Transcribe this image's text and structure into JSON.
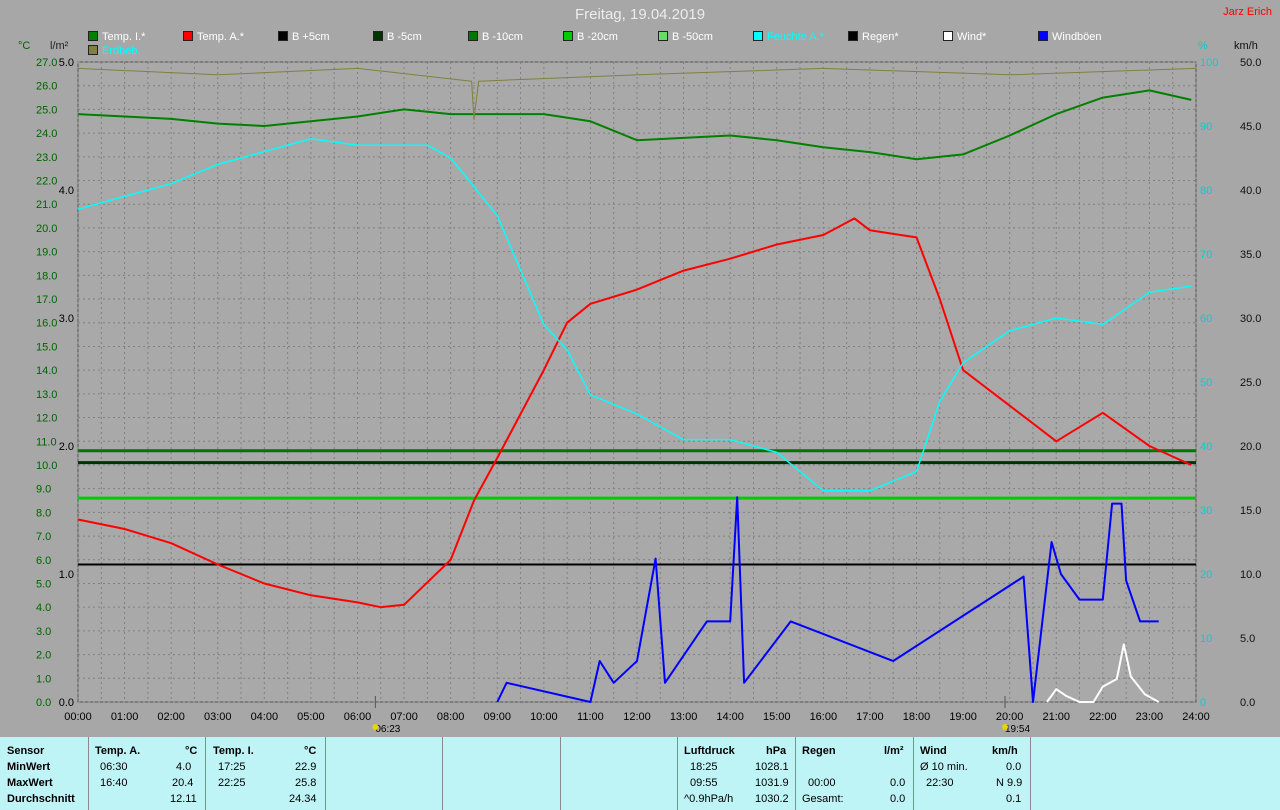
{
  "header": {
    "title": "Freitag, 19.04.2019",
    "author": "Jarz Erich"
  },
  "legend": [
    {
      "label": "Temp. I.*",
      "color": "#008000"
    },
    {
      "label": "Temp. A.*",
      "color": "#ff0000"
    },
    {
      "label": "B +5cm",
      "color": "#000000"
    },
    {
      "label": "B -5cm",
      "color": "#003300"
    },
    {
      "label": "B -10cm",
      "color": "#007700"
    },
    {
      "label": "B -20cm",
      "color": "#00cc00"
    },
    {
      "label": "B -50cm",
      "color": "#66dd66"
    },
    {
      "label": "Feuchte A.*",
      "color": "#00ffff"
    },
    {
      "label": "Regen*",
      "color": "#000000"
    },
    {
      "label": "Wind*",
      "color": "#ffffff"
    },
    {
      "label": "Windböen",
      "color": "#0000ff"
    },
    {
      "label": "Erdbeb.",
      "color": "#808040"
    }
  ],
  "units": {
    "left1": "°C",
    "left2": "l/m²",
    "right1": "%",
    "right2": "km/h"
  },
  "markers": {
    "sunrise": "06:23",
    "sunset": "19:54"
  },
  "chart_data": {
    "type": "line",
    "x_ticks": [
      "00:00",
      "01:00",
      "02:00",
      "03:00",
      "04:00",
      "05:00",
      "06:00",
      "07:00",
      "08:00",
      "09:00",
      "10:00",
      "11:00",
      "12:00",
      "13:00",
      "14:00",
      "15:00",
      "16:00",
      "17:00",
      "18:00",
      "19:00",
      "20:00",
      "21:00",
      "22:00",
      "23:00",
      "24:00"
    ],
    "xlim_hours": [
      0,
      24
    ],
    "y_temp": {
      "range": [
        0,
        27
      ],
      "ticks": [
        "0.0",
        "1.0",
        "2.0",
        "3.0",
        "4.0",
        "5.0",
        "6.0",
        "7.0",
        "8.0",
        "9.0",
        "10.0",
        "11.0",
        "12.0",
        "13.0",
        "14.0",
        "15.0",
        "16.0",
        "17.0",
        "18.0",
        "19.0",
        "20.0",
        "21.0",
        "22.0",
        "23.0",
        "24.0",
        "25.0",
        "26.0",
        "27.0"
      ]
    },
    "y_rain": {
      "range": [
        0,
        5
      ],
      "ticks": [
        "0.0",
        "1.0",
        "2.0",
        "3.0",
        "4.0",
        "5.0"
      ]
    },
    "y_humidity": {
      "range": [
        0,
        100
      ],
      "ticks": [
        "0",
        "10",
        "20",
        "30",
        "40",
        "50",
        "60",
        "70",
        "80",
        "90",
        "100"
      ]
    },
    "y_wind": {
      "range": [
        0,
        50
      ],
      "ticks": [
        "0.0",
        "5.0",
        "10.0",
        "15.0",
        "20.0",
        "25.0",
        "30.0",
        "35.0",
        "40.0",
        "45.0",
        "50.0"
      ]
    },
    "grid": true,
    "series": [
      {
        "name": "Temp. I.*",
        "axis": "temp",
        "color": "#008000",
        "x": [
          0,
          1,
          2,
          3,
          4,
          5,
          6,
          7,
          8,
          9,
          10,
          11,
          12,
          13,
          14,
          15,
          16,
          17,
          18,
          19,
          20,
          21,
          22,
          23,
          23.9
        ],
        "y": [
          24.8,
          24.7,
          24.6,
          24.4,
          24.3,
          24.5,
          24.7,
          25.0,
          24.8,
          24.8,
          24.8,
          24.5,
          23.7,
          23.8,
          23.9,
          23.7,
          23.4,
          23.2,
          22.9,
          23.1,
          23.9,
          24.8,
          25.5,
          25.8,
          25.4
        ]
      },
      {
        "name": "Temp. A.*",
        "axis": "temp",
        "color": "#ff0000",
        "x": [
          0,
          1,
          2,
          3,
          4,
          5,
          6,
          6.5,
          7,
          8,
          8.5,
          9,
          10,
          10.5,
          11,
          12,
          13,
          14,
          15,
          16,
          16.67,
          17,
          18,
          18.5,
          19,
          20,
          21,
          22,
          23,
          23.9
        ],
        "y": [
          7.7,
          7.3,
          6.7,
          5.8,
          5.0,
          4.5,
          4.2,
          4.0,
          4.1,
          6.0,
          8.5,
          10.3,
          14.0,
          16.0,
          16.8,
          17.4,
          18.2,
          18.7,
          19.3,
          19.7,
          20.4,
          19.9,
          19.6,
          17.0,
          14.0,
          12.5,
          11.0,
          12.2,
          10.8,
          10.0
        ]
      },
      {
        "name": "Feuchte A.*",
        "axis": "humidity",
        "color": "#00ffff",
        "x": [
          0,
          1,
          2,
          3,
          4,
          5,
          6,
          7,
          7.5,
          8,
          9,
          10,
          10.5,
          11,
          12,
          13,
          14,
          15,
          16,
          16.5,
          17,
          18,
          18.5,
          19,
          20,
          21,
          22,
          23,
          23.9
        ],
        "y": [
          77,
          79,
          81,
          84,
          86,
          88,
          87,
          87,
          87,
          85,
          76,
          59,
          55,
          48,
          45,
          41,
          41,
          39,
          33,
          33,
          33,
          36,
          47,
          53,
          58,
          60,
          59,
          64,
          65
        ]
      },
      {
        "name": "Erdbeb.",
        "axis": "humidity",
        "color": "#808040",
        "x": [
          0,
          3,
          6,
          8.45,
          8.5,
          8.6,
          12,
          16,
          20,
          24
        ],
        "y": [
          99,
          98,
          99,
          97,
          91,
          97,
          98,
          99,
          98,
          99
        ]
      },
      {
        "name": "Wind*",
        "axis": "wind",
        "color": "#ffffff",
        "x": [
          20.8,
          21.0,
          21.2,
          21.5,
          21.8,
          22.0,
          22.3,
          22.45,
          22.6,
          22.9,
          23.2
        ],
        "y": [
          0,
          1,
          0.5,
          0,
          0,
          1.2,
          1.8,
          4.5,
          2.0,
          0.6,
          0
        ]
      },
      {
        "name": "Windböen",
        "axis": "wind",
        "color": "#0000ff",
        "x": [
          9,
          9.2,
          11,
          11.2,
          11.5,
          12,
          12.4,
          12.6,
          13.5,
          14.0,
          14.15,
          14.3,
          15.3,
          17.5,
          20.3,
          20.5,
          20.9,
          21.1,
          21.5,
          22.0,
          22.2,
          22.4,
          22.5,
          22.8,
          23.2
        ],
        "y": [
          0,
          1.5,
          0,
          3.2,
          1.5,
          3.2,
          11.2,
          1.5,
          6.3,
          6.3,
          16.0,
          1.5,
          6.3,
          3.2,
          9.8,
          0,
          12.5,
          10,
          8,
          8,
          15.5,
          15.5,
          9.5,
          6.3,
          6.3
        ]
      }
    ],
    "reference_lines": [
      {
        "label": "B -10cm",
        "axis": "temp",
        "value": 10.6,
        "color": "#007700"
      },
      {
        "label": "B -5cm",
        "axis": "temp",
        "value": 10.1,
        "color": "#003300"
      },
      {
        "label": "B -20cm",
        "axis": "temp",
        "value": 8.6,
        "color": "#00cc00"
      },
      {
        "label": "B +5cm",
        "axis": "temp",
        "value": 5.8,
        "color": "#000000"
      }
    ]
  },
  "stats": {
    "sensor": {
      "label": "Sensor",
      "min": "MinWert",
      "max": "MaxWert",
      "avg": "Durchschnitt"
    },
    "temp_a": {
      "label": "Temp. A.",
      "unit": "°C",
      "min_time": "06:30",
      "min_val": "4.0",
      "max_time": "16:40",
      "max_val": "20.4",
      "avg": "12.11"
    },
    "temp_i": {
      "label": "Temp. I.",
      "unit": "°C",
      "min_time": "17:25",
      "min_val": "22.9",
      "max_time": "22:25",
      "max_val": "25.8",
      "avg": "24.34"
    },
    "pressure": {
      "label": "Luftdruck",
      "unit": "hPa",
      "min_time": "18:25",
      "min_val": "1028.1",
      "max_time": "09:55",
      "max_val": "1031.9",
      "trend_label": "^0.9hPa/h",
      "trend_val": "1030.2"
    },
    "rain": {
      "label": "Regen",
      "unit": "l/m²",
      "max_time": "00:00",
      "max_val": "0.0",
      "total_label": "Gesamt:",
      "total_val": "0.0"
    },
    "wind": {
      "label": "Wind",
      "unit": "km/h",
      "min_label": "Ø 10 min.",
      "min_val": "0.0",
      "max_time": "22:30",
      "max_val": "N 9.9",
      "avg": "0.1"
    }
  }
}
